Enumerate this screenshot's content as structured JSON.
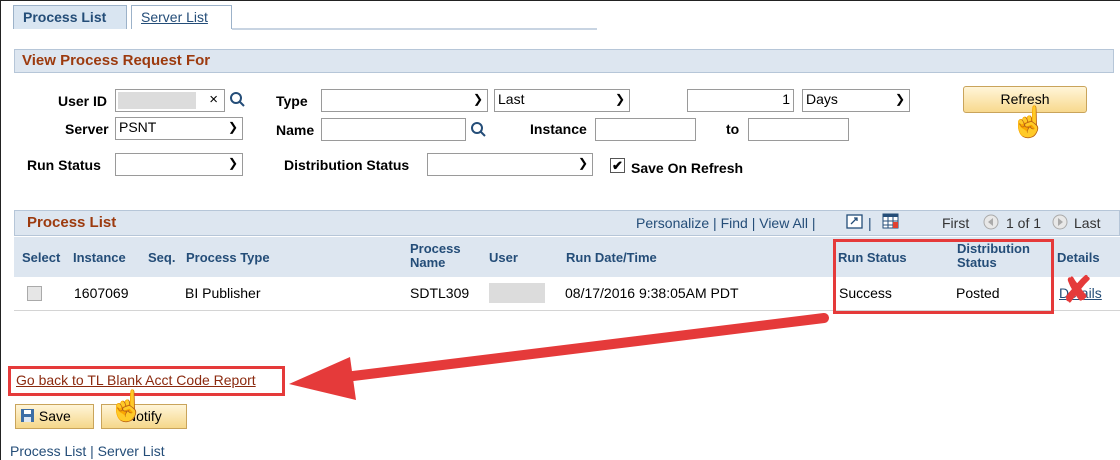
{
  "tabs": [
    {
      "label": "Process List",
      "active": true
    },
    {
      "label": "Server List",
      "active": false
    }
  ],
  "request": {
    "section_title": "View Process Request For",
    "user_id_label": "User ID",
    "user_id_clear": "×",
    "type_label": "Type",
    "type_value": "",
    "period_value": "Last",
    "count_value": "1",
    "unit_value": "Days",
    "refresh_label": "Refresh",
    "server_label": "Server",
    "server_value": "PSNT",
    "name_label": "Name",
    "name_value": "",
    "instance_label": "Instance",
    "instance_from": "",
    "to_label": "to",
    "instance_to": "",
    "run_status_label": "Run Status",
    "run_status_value": "",
    "dist_status_label": "Distribution Status",
    "dist_status_value": "",
    "save_on_refresh_label": "Save On Refresh",
    "save_on_refresh_checked": true
  },
  "grid": {
    "title": "Process List",
    "personalize": "Personalize",
    "find": "Find",
    "view_all": "View All",
    "sep": "|",
    "first": "First",
    "page_info": "1 of 1",
    "last": "Last",
    "columns": {
      "select": "Select",
      "instance": "Instance",
      "seq": "Seq.",
      "process_type": "Process Type",
      "process_name": "Process Name",
      "user": "User",
      "run_datetime": "Run Date/Time",
      "run_status": "Run Status",
      "distribution_status": "Distribution Status",
      "details": "Details"
    },
    "rows": [
      {
        "instance": "1607069",
        "seq": "",
        "process_type": "BI Publisher",
        "process_name": "SDTL309",
        "run_datetime": "08/17/2016  9:38:05AM PDT",
        "run_status": "Success",
        "distribution_status": "Posted",
        "details": "Details"
      }
    ]
  },
  "footer": {
    "back_link": "Go back to TL Blank Acct Code Report",
    "save_label": "Save",
    "notify_label": "Notify",
    "bottom_process_list": "Process List",
    "bottom_sep": "|",
    "bottom_server_list": "Server List"
  },
  "annotation": {
    "accent": "#e53a3a",
    "cross": "✘"
  }
}
